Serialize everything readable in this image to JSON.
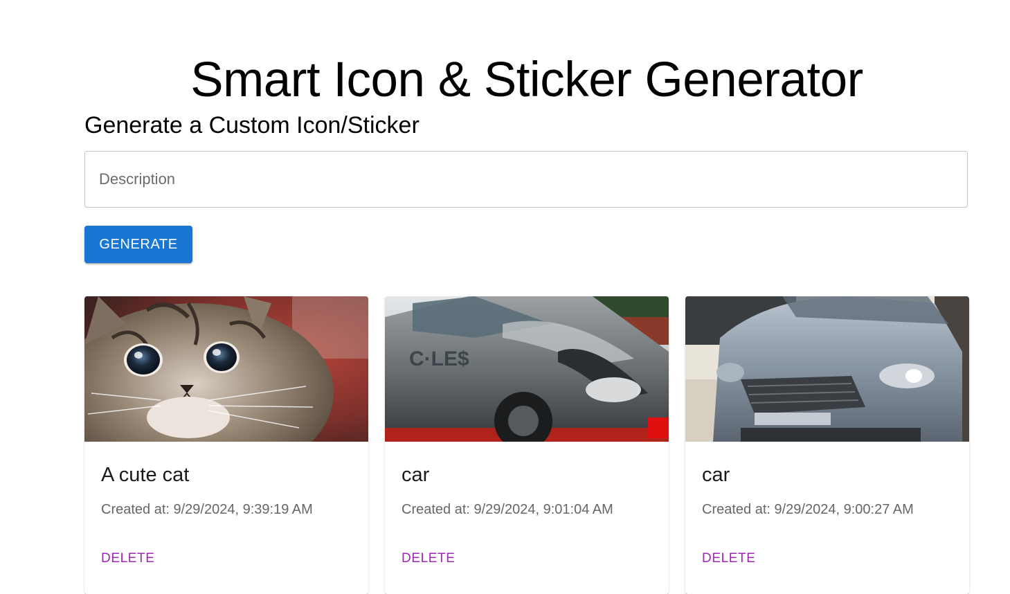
{
  "header": {
    "title": "Smart Icon & Sticker Generator"
  },
  "form": {
    "section_title": "Generate a Custom Icon/Sticker",
    "description_placeholder": "Description",
    "description_value": "",
    "generate_label": "GENERATE"
  },
  "colors": {
    "primary": "#1976d2",
    "secondary": "#9c27b0"
  },
  "cards": [
    {
      "title": "A cute cat",
      "created": "Created at: 9/29/2024, 9:39:19 AM",
      "delete_label": "DELETE",
      "image": "kitten-photo"
    },
    {
      "title": "car",
      "created": "Created at: 9/29/2024, 9:01:04 AM",
      "delete_label": "DELETE",
      "image": "grey-car-side-photo"
    },
    {
      "title": "car",
      "created": "Created at: 9/29/2024, 9:00:27 AM",
      "delete_label": "DELETE",
      "image": "silver-car-front-photo"
    }
  ]
}
